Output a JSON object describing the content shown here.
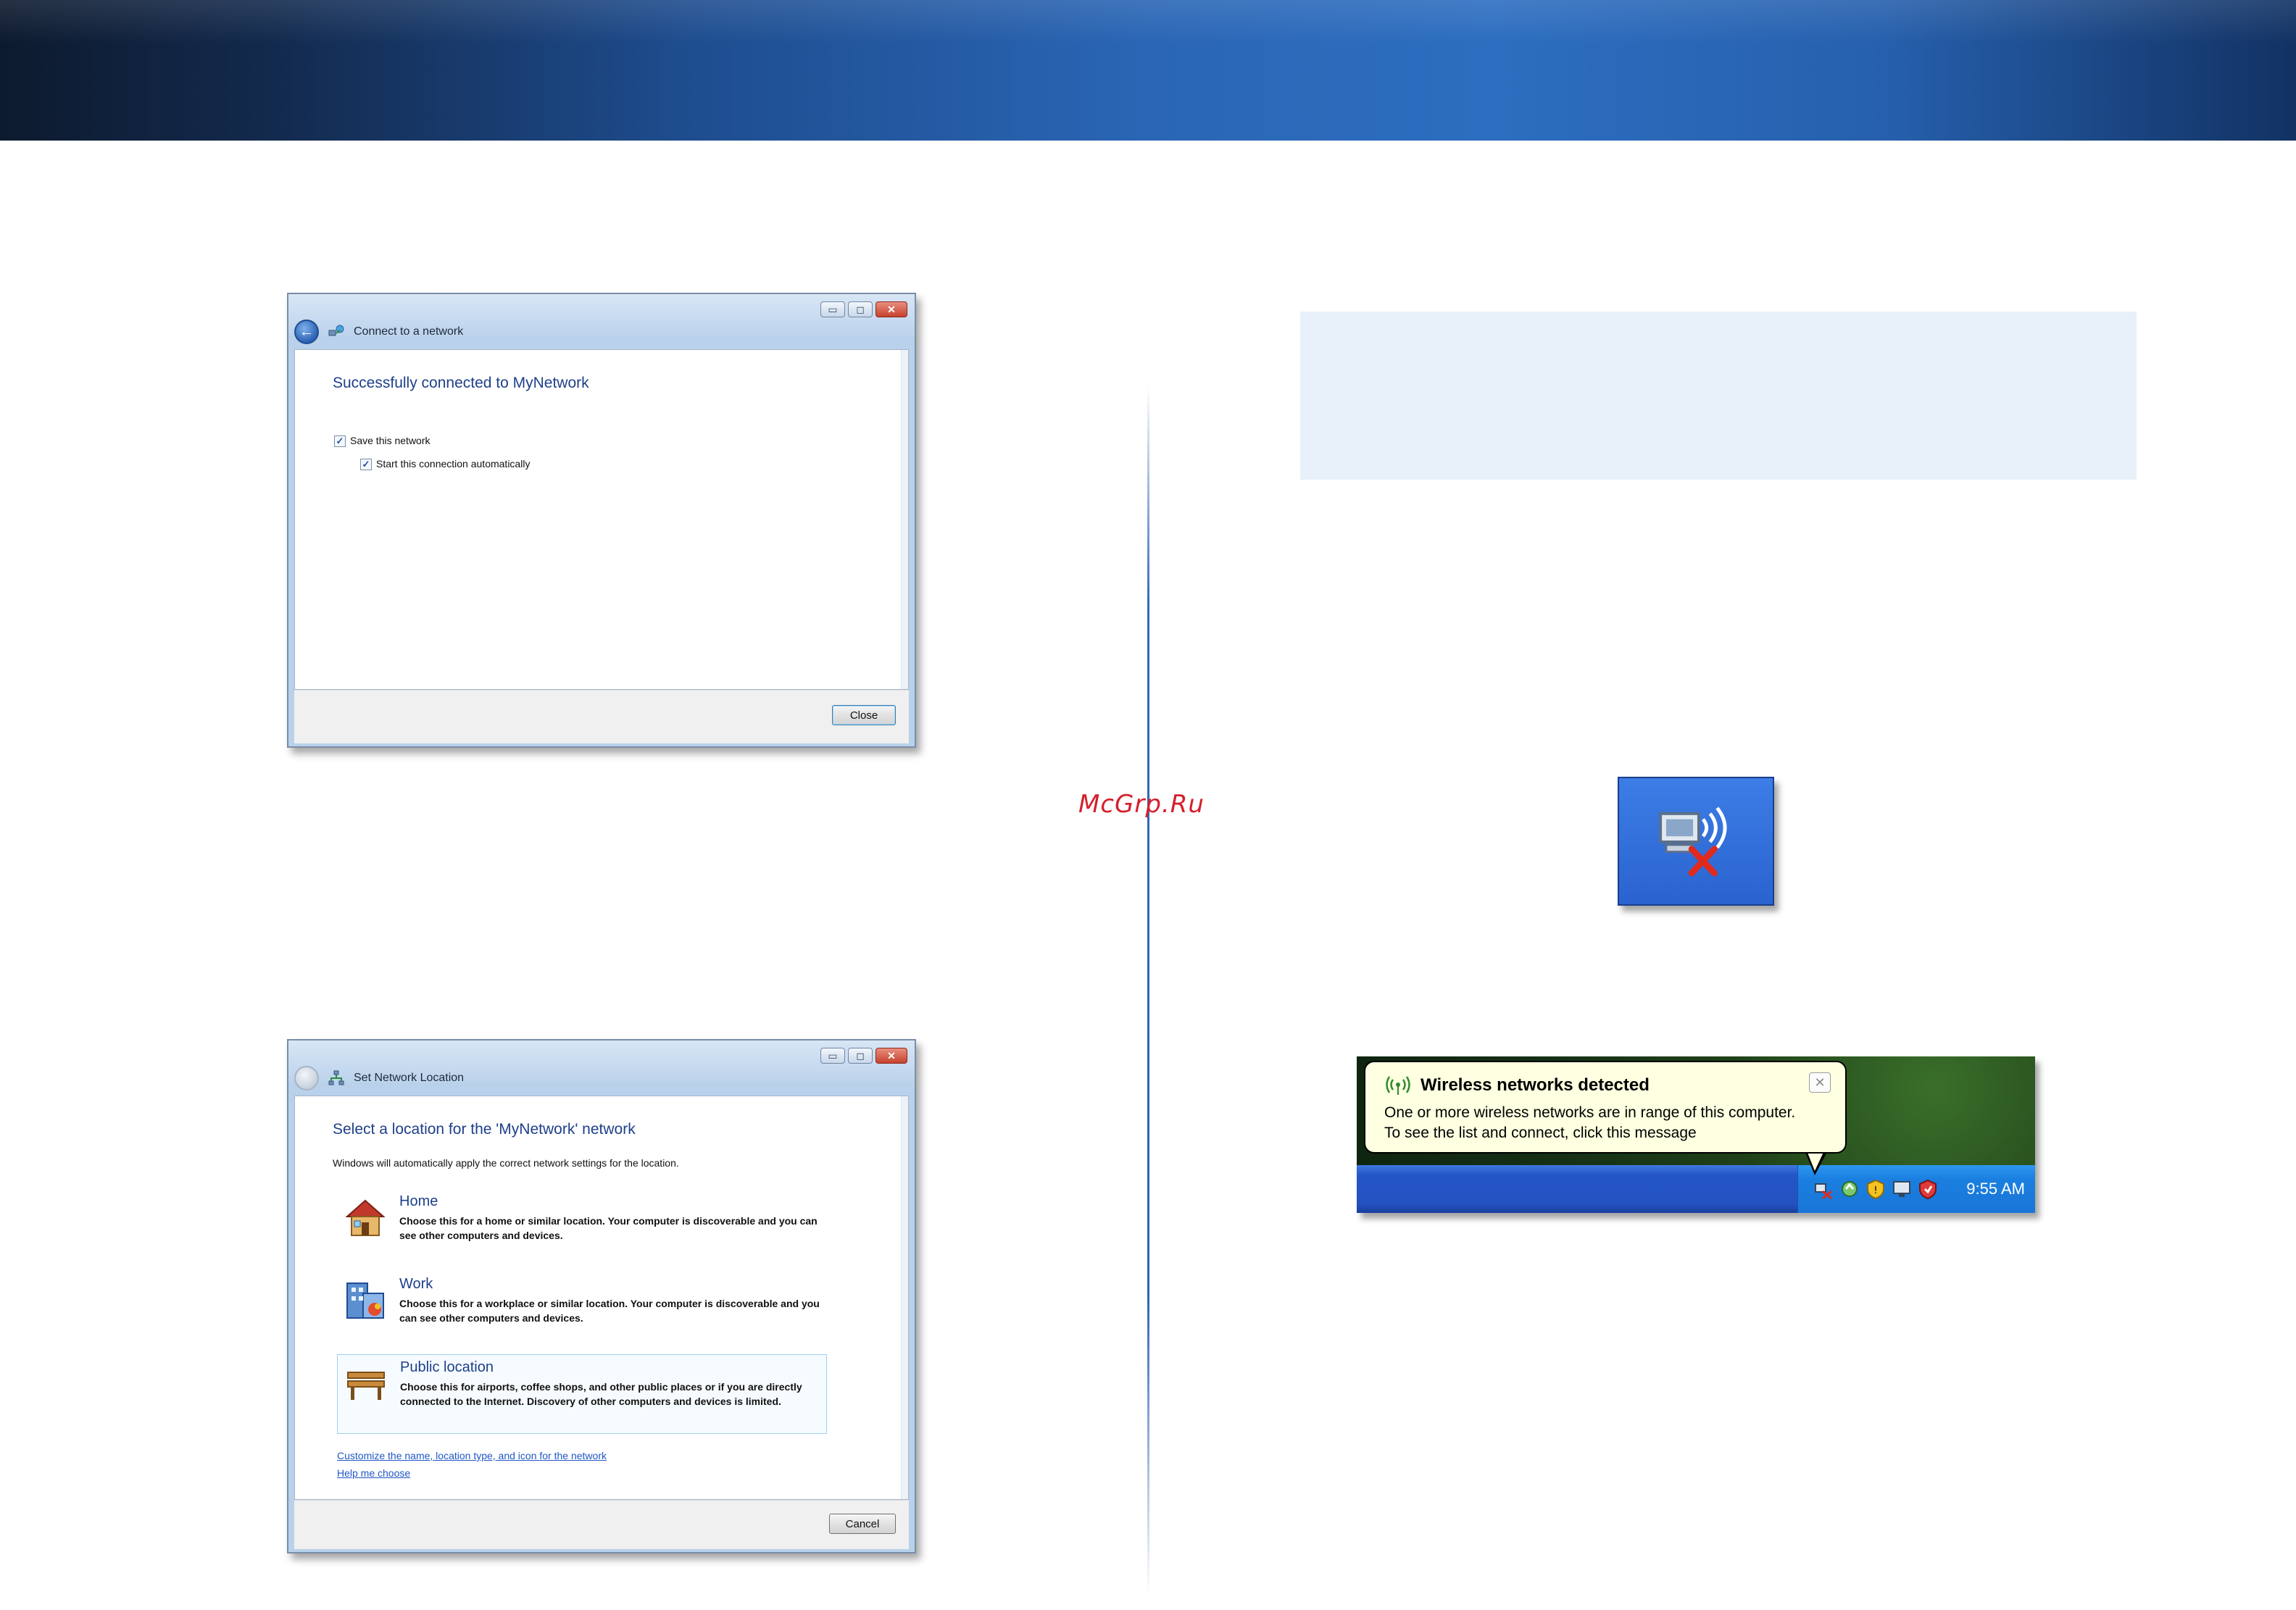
{
  "watermark": "McGrp.Ru",
  "window_connect": {
    "title": "Connect to a network",
    "heading": "Successfully connected to MyNetwork",
    "checkbox_save": "Save this network",
    "checkbox_auto": "Start this connection automatically",
    "close_button": "Close",
    "checkbox_save_checked": true,
    "checkbox_auto_checked": true
  },
  "window_location": {
    "title": "Set Network Location",
    "heading": "Select a location for the 'MyNetwork' network",
    "intro": "Windows will automatically apply the correct network settings for the location.",
    "options": [
      {
        "title": "Home",
        "description": "Choose this for a home or similar location. Your computer is discoverable and you can see other computers and devices.",
        "icon": "house-icon"
      },
      {
        "title": "Work",
        "description": "Choose this for a workplace or similar location. Your computer is discoverable and you can see other computers and devices.",
        "icon": "office-building-icon"
      },
      {
        "title": "Public location",
        "description": "Choose this for airports, coffee shops, and other public places or if you are directly connected to the Internet. Discovery of other computers and devices is limited.",
        "icon": "park-bench-icon",
        "selected": true
      }
    ],
    "link_customize": "Customize the name, location type, and icon for the network",
    "link_help": "Help me choose",
    "cancel_button": "Cancel"
  },
  "tray_tile": {
    "icon": "wireless-network-disconnected-icon"
  },
  "xp_notification": {
    "title": "Wireless networks detected",
    "line1": "One or more wireless networks are in range of this computer.",
    "line2": "To see the list and connect, click this message",
    "clock": "9:55 AM",
    "tray_icons": [
      "wireless-network-disconnected-icon",
      "refresh-icon",
      "security-shield-icon",
      "monitor-icon",
      "antivirus-shield-icon"
    ]
  },
  "colors": {
    "header_band": "#1e4d8f",
    "note_box": "#e8f0f9",
    "divider": "#3569b8",
    "watermark": "#d4202c",
    "link": "#1f57c6"
  }
}
